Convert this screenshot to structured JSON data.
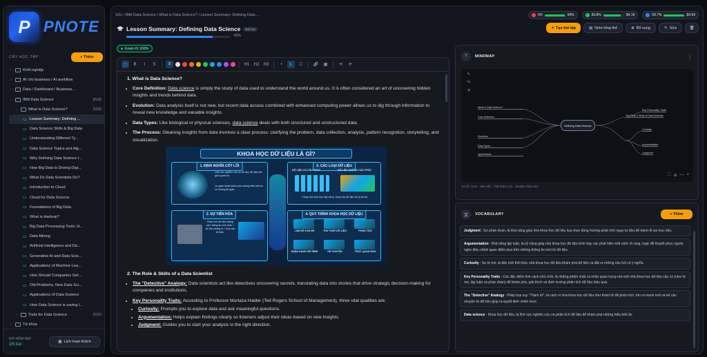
{
  "app": {
    "logo_letter": "P",
    "logo_text": "PNOTE"
  },
  "sidebar": {
    "header": "CÂY HỌC TẬP",
    "add_label": "+ Thêm",
    "items": [
      {
        "label": "Khởi nghiệp",
        "type": "folder",
        "level": 0,
        "chev": "›"
      },
      {
        "label": "AI cho business / AI workflow",
        "type": "folder",
        "level": 0,
        "chev": "›"
      },
      {
        "label": "Data / Dashboard / Business...",
        "type": "folder",
        "level": 0,
        "chev": "›"
      },
      {
        "label": "IBM Data Science",
        "type": "folder",
        "level": 0,
        "chev": "⌄",
        "count": "35/35"
      },
      {
        "label": "What is Data Science?",
        "type": "folder",
        "level": 1,
        "chev": "⌄",
        "count": "20/20"
      },
      {
        "label": "Lesson Summary: Defining ...",
        "type": "lesson",
        "level": 2,
        "active": true
      },
      {
        "label": "Data Science Skills & Big Data",
        "type": "lesson",
        "level": 2
      },
      {
        "label": "Understanding Different Ty...",
        "type": "lesson",
        "level": 2
      },
      {
        "label": "Data Science Topics and Alg...",
        "type": "lesson",
        "level": 2
      },
      {
        "label": "Why Defining Data Science I...",
        "type": "lesson",
        "level": 2
      },
      {
        "label": "How Big Data is Driving Digi...",
        "type": "lesson",
        "level": 2
      },
      {
        "label": "What Do Data Scientists Do?",
        "type": "lesson",
        "level": 2
      },
      {
        "label": "Introduction to Cloud",
        "type": "lesson",
        "level": 2
      },
      {
        "label": "Cloud for Data Science",
        "type": "lesson",
        "level": 2
      },
      {
        "label": "Foundations of Big Data",
        "type": "lesson",
        "level": 2
      },
      {
        "label": "What is Hadoop?",
        "type": "lesson",
        "level": 2
      },
      {
        "label": "Big Data Processing Tools: H...",
        "type": "lesson",
        "level": 2
      },
      {
        "label": "Data Mining",
        "type": "lesson",
        "level": 2
      },
      {
        "label": "Artificial Intelligence and Da...",
        "type": "lesson",
        "level": 2
      },
      {
        "label": "Generative AI and Data Scie...",
        "type": "lesson",
        "level": 2
      },
      {
        "label": "Applications of Machine Lea...",
        "type": "lesson",
        "level": 2
      },
      {
        "label": "How Should Companies Get...",
        "type": "lesson",
        "level": 2
      },
      {
        "label": "Old Problems, New Data Sci...",
        "type": "lesson",
        "level": 2
      },
      {
        "label": "Applications of Data Science",
        "type": "lesson",
        "level": 2
      },
      {
        "label": "How Data Science is saving l...",
        "type": "lesson",
        "level": 2
      },
      {
        "label": "Tools for Data Science",
        "type": "folder",
        "level": 1,
        "chev": "›",
        "count": "15/15"
      },
      {
        "label": "Từ khóa",
        "type": "folder",
        "level": 0,
        "chev": "›"
      },
      {
        "label": "Data Science Method...",
        "type": "folder",
        "level": 0,
        "chev": "›"
      }
    ],
    "footer": {
      "streak_label": "KPI HÔM NAY",
      "streak_value": "3/5 bài",
      "history_label": "Lịch hoạn thành"
    }
  },
  "topbar": {
    "breadcrumb": "Gốc / IBM Data Science / What is Data Science? / Lesson Summary: Defining Data ...",
    "stats": [
      {
        "label": "5H",
        "value": "99%",
        "dot": "#ef4444",
        "fill": 0.99
      },
      {
        "label": "83.8%",
        "value": "$4.19",
        "dot": "#22c55e",
        "fill": 0.84
      },
      {
        "label": "99.7%",
        "value": "$4.99",
        "dot": "#3b82f6",
        "fill": 0.99
      }
    ]
  },
  "lesson": {
    "title": "Lesson Summary: Defining Data Science",
    "tag": "Bài học",
    "progress": 0.83,
    "progress_text": "83%",
    "exam_chip": "Exam #1 100%"
  },
  "actions": {
    "create_exercise": "Tạo bài tập",
    "summary_note": "Note tổng thể",
    "supplement": "Bổ sung",
    "edit": "Sửa"
  },
  "toolbar": {
    "buttons": [
      "B",
      "I",
      "S",
      "H1",
      "H2",
      "H3",
      "•",
      "1.",
      "☐",
      "🔗",
      "▦",
      "⟲",
      "⟳"
    ],
    "swatches": [
      "#e5e7eb",
      "#ef4444",
      "#f97316",
      "#eab308",
      "#22c55e",
      "#06b6d4",
      "#3b82f6",
      "#a855f7",
      "#ec4899"
    ]
  },
  "content": {
    "s1_heading": "1. What is Data Science?",
    "s1_items": [
      {
        "term": "Core Definition:",
        "pre": "",
        "link": "Data science",
        "text": " is simply the study of data used to understand the world around us. It is often considered an art of uncovering hidden insights and trends behind data."
      },
      {
        "term": "Evolution:",
        "pre": " Data analysis itself is not new, but recent data access combined with enhanced computing power allows us to dig through information to reveal new knowledge and valuable insights.",
        "link": "",
        "text": ""
      },
      {
        "term": "Data Types:",
        "pre": " Like biological or physical sciences, ",
        "link": "data science",
        "text": " deals with both structured and unstructured data."
      },
      {
        "term": "The Process:",
        "pre": " Gleaning insights from data involves a clear process: clarifying the problem, data collection, analysis, pattern recognition, storytelling, and visualization.",
        "link": "",
        "text": ""
      }
    ],
    "infographic": {
      "title": "KHOA HỌC DỮ LIỆU LÀ GÌ?",
      "box1": "1. ĐỊNH NGHĨA CỐT LÕI",
      "box1_text": "Là nghệ thuật khám phá những hiểu biết và xu hướng ẩn giấu.",
      "box1_text2": "Lĩnh vực nghiên cứu về dữ liệu để hiểu thế giới quanh ta.",
      "box2": "2. SỰ TIẾN HÓA",
      "box2_text": "Phân tích dữ liệu không mới. Năng lực tính toán + dữ liệu khổng lồ = Đào sâu tri thức.",
      "box3": "3. CÁC LOẠI DỮ LIỆU",
      "box3_col1": "DỮ LIỆU CÓ CẤU TRÚC",
      "box3_col2": "DỮ LIỆU KHÔNG CẤU TRÚC",
      "box3_text": "Cũng như sinh học hay vật lý, khoa học dữ liệu xử lý cả hai.",
      "box4": "4. QUY TRÌNH KHOA HỌC DỮ LIỆU",
      "box4_steps": [
        "LÀM RÕ VẤN ĐỀ",
        "THU THẬP DỮ LIỆU",
        "PHÂN TÍCH",
        "NHẬN DẠNG MÔ HÌNH",
        "KỂ CHUYỆN",
        "TRỰC QUAN HÓA"
      ]
    },
    "s2_heading": "2. The Role & Skills of a Data Scientist",
    "s2_items": [
      {
        "term": "The \"Detective\" Analogy:",
        "text": " Data scientists act like detectives uncovering secrets, translating data into stories that drive strategic decision-making for companies and institutions."
      },
      {
        "term": "Key Personality Traits:",
        "text": " According to Professor Murtaza Haider (Ted Rogers School of Management), three vital qualities are:"
      }
    ],
    "traits": [
      {
        "term": "Curiosity:",
        "text": " Prompts you to explore data and ask meaningful questions."
      },
      {
        "term": "Argumentation:",
        "text": " Helps explain findings clearly so listeners adjust their ideas based on new insights."
      },
      {
        "term": "Judgment:",
        "text": " Guides you to start your analysis in the right direction."
      }
    ]
  },
  "mindmap": {
    "title": "MINDMAP",
    "center": "Defining Data Science",
    "hint": "Scroll zoom · kéo nền · Tab thêm con · double-click sửa",
    "zoom_tools": [
      "⛶",
      "⊖",
      "—",
      "+"
    ],
    "left_nodes": [
      "What is Data Science?",
      "Core Definition",
      "Evolution",
      "Data Types",
      "Applications"
    ],
    "right_nodes": [
      "The Role & Skills of Data Scientist",
      "Key Personality Traits",
      "Curiosity",
      "Argumentation",
      "Judgment"
    ]
  },
  "vocabulary": {
    "title": "VOCABULARY",
    "add_label": "+ Thêm",
    "items": [
      {
        "term": "Judgment",
        "def": " : Sự phán đoán, là khả năng giúp nhà khoa học dữ liệu lựa chọn đúng hướng phân tích ngay từ đầu để tránh đi sai mục tiêu."
      },
      {
        "term": "Argumentation",
        "def": " : Khả năng lập luận, là kỹ năng giúp nhà khoa học dữ liệu trình bày các phát hiện một cách rõ ràng, logic để thuyết phục người nghe điều chỉnh quan điểm dựa trên những thông tin mới từ dữ liệu."
      },
      {
        "term": "Curiosity",
        "def": " : Sự tò mò, là đặc tính thôi thúc nhà khoa học dữ liệu khám phá dữ liệu và đặt ra những câu hỏi có ý nghĩa."
      },
      {
        "term": "Key Personality Traits",
        "def": " : Các đặc điểm tính cách chủ chốt, là những phẩm chất cá nhân quan trọng mà một nhà khoa học dữ liệu cần có (như tò mò, lập luận và phán đoán) để khám phá, giải thích và định hướng phân tích dữ liệu hiệu quả."
      },
      {
        "term": "The \"Detective\" Analogy",
        "def": " : Phép loại suy \"Thám tử\", là cách ví nhà khoa học dữ liệu như thám tử để phân tích, tìm ra manh mối và kể câu chuyện từ dữ liệu giúp ra quyết định chiến lược."
      },
      {
        "term": "Data science",
        "def": " : Khoa học dữ liệu, là lĩnh vực nghiên cứu và phân tích dữ liệu để khám phá những hiểu biết ẩn"
      }
    ]
  },
  "colors": {
    "accent": "#f59e0b",
    "primary": "#3b82f6",
    "success": "#34d399",
    "bg": "#0b0d12"
  }
}
